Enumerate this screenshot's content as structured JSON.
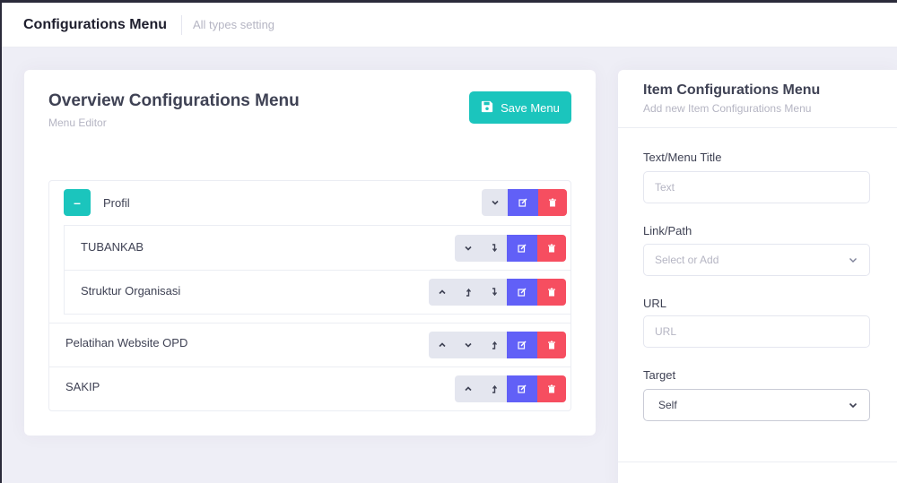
{
  "header": {
    "title": "Configurations Menu",
    "subtitle": "All types setting"
  },
  "overview": {
    "title": "Overview Configurations Menu",
    "subtitle": "Menu Editor",
    "save_label": "Save Menu",
    "items": [
      {
        "label": "Profil",
        "collapse_symbol": "–",
        "actions": [
          "chevron-down",
          "edit",
          "delete"
        ],
        "children": [
          {
            "label": "TUBANKAB",
            "actions": [
              "chevron-down",
              "outdent",
              "edit",
              "delete"
            ]
          },
          {
            "label": "Struktur Organisasi",
            "actions": [
              "chevron-up",
              "indent",
              "outdent",
              "edit",
              "delete"
            ]
          }
        ]
      },
      {
        "label": "Pelatihan Website OPD",
        "actions": [
          "chevron-up",
          "chevron-down",
          "indent",
          "edit",
          "delete"
        ]
      },
      {
        "label": "SAKIP",
        "actions": [
          "chevron-up",
          "indent",
          "edit",
          "delete"
        ]
      }
    ]
  },
  "form": {
    "title": "Item Configurations Menu",
    "subtitle": "Add new Item Configurations Menu",
    "text_label": "Text/Menu Title",
    "text_placeholder": "Text",
    "link_label": "Link/Path",
    "link_placeholder": "Select or Add",
    "url_label": "URL",
    "url_placeholder": "URL",
    "target_label": "Target",
    "target_value": "Self"
  },
  "colors": {
    "accent": "#1bc5bd",
    "edit": "#6160f7",
    "delete": "#f64e60",
    "background": "#eeeef6"
  }
}
